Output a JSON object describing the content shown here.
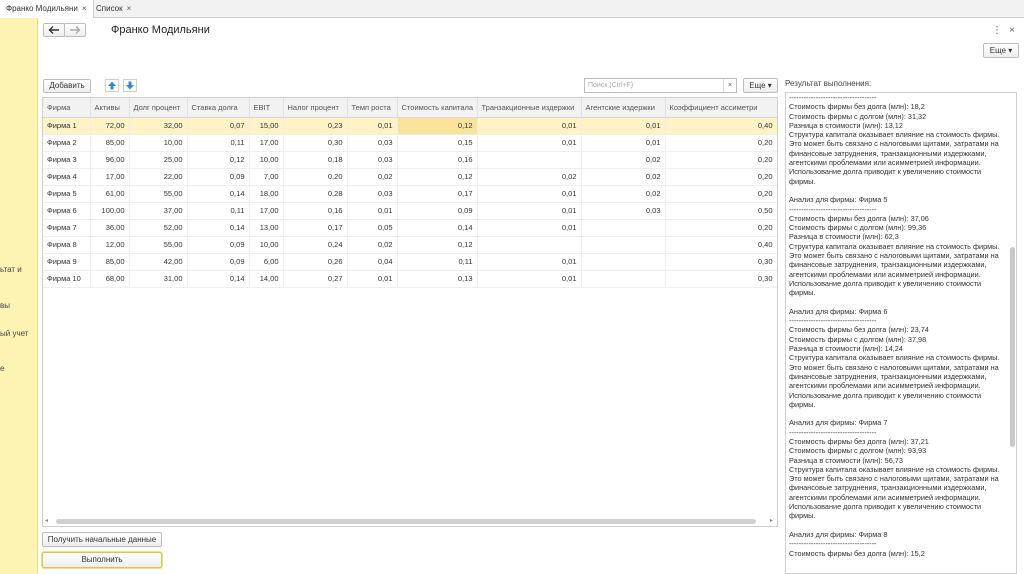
{
  "tabs": [
    {
      "label": "Франко Модильяни",
      "close": "×"
    },
    {
      "label": "Список",
      "close": "×"
    }
  ],
  "sidebar": {
    "items": [
      "ьтат и",
      "вы",
      "ый учет",
      "е"
    ]
  },
  "header": {
    "title": "Франко Модильяни",
    "back_icon": "arrow-left-icon",
    "forward_icon": "arrow-right-icon",
    "more_label": "Еще ▾",
    "menu_icon": "⋮",
    "close_icon": "×"
  },
  "toolbar": {
    "add_label": "Добавить",
    "search_placeholder": "Поиск (Ctrl+F)",
    "search_clear": "×",
    "more_label": "Еще ▾"
  },
  "table": {
    "columns": [
      "Фирма",
      "Активы",
      "Долг процент",
      "Ставка долга",
      "EBIT",
      "Налог процент",
      "Темп роста",
      "Стоимость капитала",
      "Транзакционные издержки",
      "Агентские издержки",
      "Коэффициент ассиметри"
    ],
    "rows": [
      [
        "Фирма 1",
        "72,00",
        "32,00",
        "0,07",
        "15,00",
        "0,23",
        "0,01",
        "0,12",
        "0,01",
        "0,01",
        "0,40"
      ],
      [
        "Фирма 2",
        "85,00",
        "10,00",
        "0,11",
        "17,00",
        "0,30",
        "0,03",
        "0,15",
        "0,01",
        "0,01",
        "0,20"
      ],
      [
        "Фирма 3",
        "96,00",
        "25,00",
        "0,12",
        "10,00",
        "0,18",
        "0,03",
        "0,16",
        "",
        "0,02",
        "0,20"
      ],
      [
        "Фирма 4",
        "17,00",
        "22,00",
        "0,09",
        "7,00",
        "0,20",
        "0,02",
        "0,12",
        "0,02",
        "0,02",
        "0,20"
      ],
      [
        "Фирма 5",
        "61,00",
        "55,00",
        "0,14",
        "18,00",
        "0,28",
        "0,03",
        "0,17",
        "0,01",
        "0,02",
        "0,20"
      ],
      [
        "Фирма 6",
        "100,00",
        "37,00",
        "0,11",
        "17,00",
        "0,16",
        "0,01",
        "0,09",
        "0,01",
        "0,03",
        "0,50"
      ],
      [
        "Фирма 7",
        "36,00",
        "52,00",
        "0,14",
        "13,00",
        "0,17",
        "0,05",
        "0,14",
        "0,01",
        "",
        "0,20"
      ],
      [
        "Фирма 8",
        "12,00",
        "55,00",
        "0,09",
        "10,00",
        "0,24",
        "0,02",
        "0,12",
        "",
        "",
        "0,40"
      ],
      [
        "Фирма 9",
        "85,00",
        "42,00",
        "0,09",
        "6,00",
        "0,26",
        "0,04",
        "0,11",
        "0,01",
        "",
        "0,30"
      ],
      [
        "Фирма 10",
        "68,00",
        "31,00",
        "0,14",
        "14,00",
        "0,27",
        "0,01",
        "0,13",
        "0,01",
        "",
        "0,30"
      ]
    ]
  },
  "buttons": {
    "get_data": "Получить начальные данные",
    "execute": "Выполнить"
  },
  "result": {
    "label": "Результат выполнения:",
    "text": "------------------------------------\nСтоимость фирмы без долга (млн): 18,2\nСтоимость фирмы с долгом (млн): 31,32\nРазница в стоимости (млн): 13,12\nСтруктура капитала оказывает влияние на стоимость фирмы. Это может быть связано с налоговыми щитами, затратами на финансовые затруднения, транзакционными издержками, агентскими проблемами или асимметрией информации.\nИспользование долга приводит к увеличению стоимости фирмы.\n\nАнализ для фирмы: Фирма 5\n------------------------------------\nСтоимость фирмы без долга (млн): 37,06\nСтоимость фирмы с долгом (млн): 99,36\nРазница в стоимости (млн): 62,3\nСтруктура капитала оказывает влияние на стоимость фирмы. Это может быть связано с налоговыми щитами, затратами на финансовые затруднения, транзакционными издержками, агентскими проблемами или асимметрией информации.\nИспользование долга приводит к увеличению стоимости фирмы.\n\nАнализ для фирмы: Фирма 6\n------------------------------------\nСтоимость фирмы без долга (млн): 23,74\nСтоимость фирмы с долгом (млн): 37,98\nРазница в стоимости (млн): 14,24\nСтруктура капитала оказывает влияние на стоимость фирмы. Это может быть связано с налоговыми щитами, затратами на финансовые затруднения, транзакционными издержками, агентскими проблемами или асимметрией информации.\nИспользование долга приводит к увеличению стоимости фирмы.\n\nАнализ для фирмы: Фирма 7\n------------------------------------\nСтоимость фирмы без долга (млн): 37,21\nСтоимость фирмы с долгом (млн): 93,93\nРазница в стоимости (млн): 56,73\nСтруктура капитала оказывает влияние на стоимость фирмы. Это может быть связано с налоговыми щитами, затратами на финансовые затруднения, транзакционными издержками, агентскими проблемами или асимметрией информации.\nИспользование долга приводит к увеличению стоимости фирмы.\n\nАнализ для фирмы: Фирма 8\n------------------------------------\nСтоимость фирмы без долга (млн): 15,2"
  }
}
